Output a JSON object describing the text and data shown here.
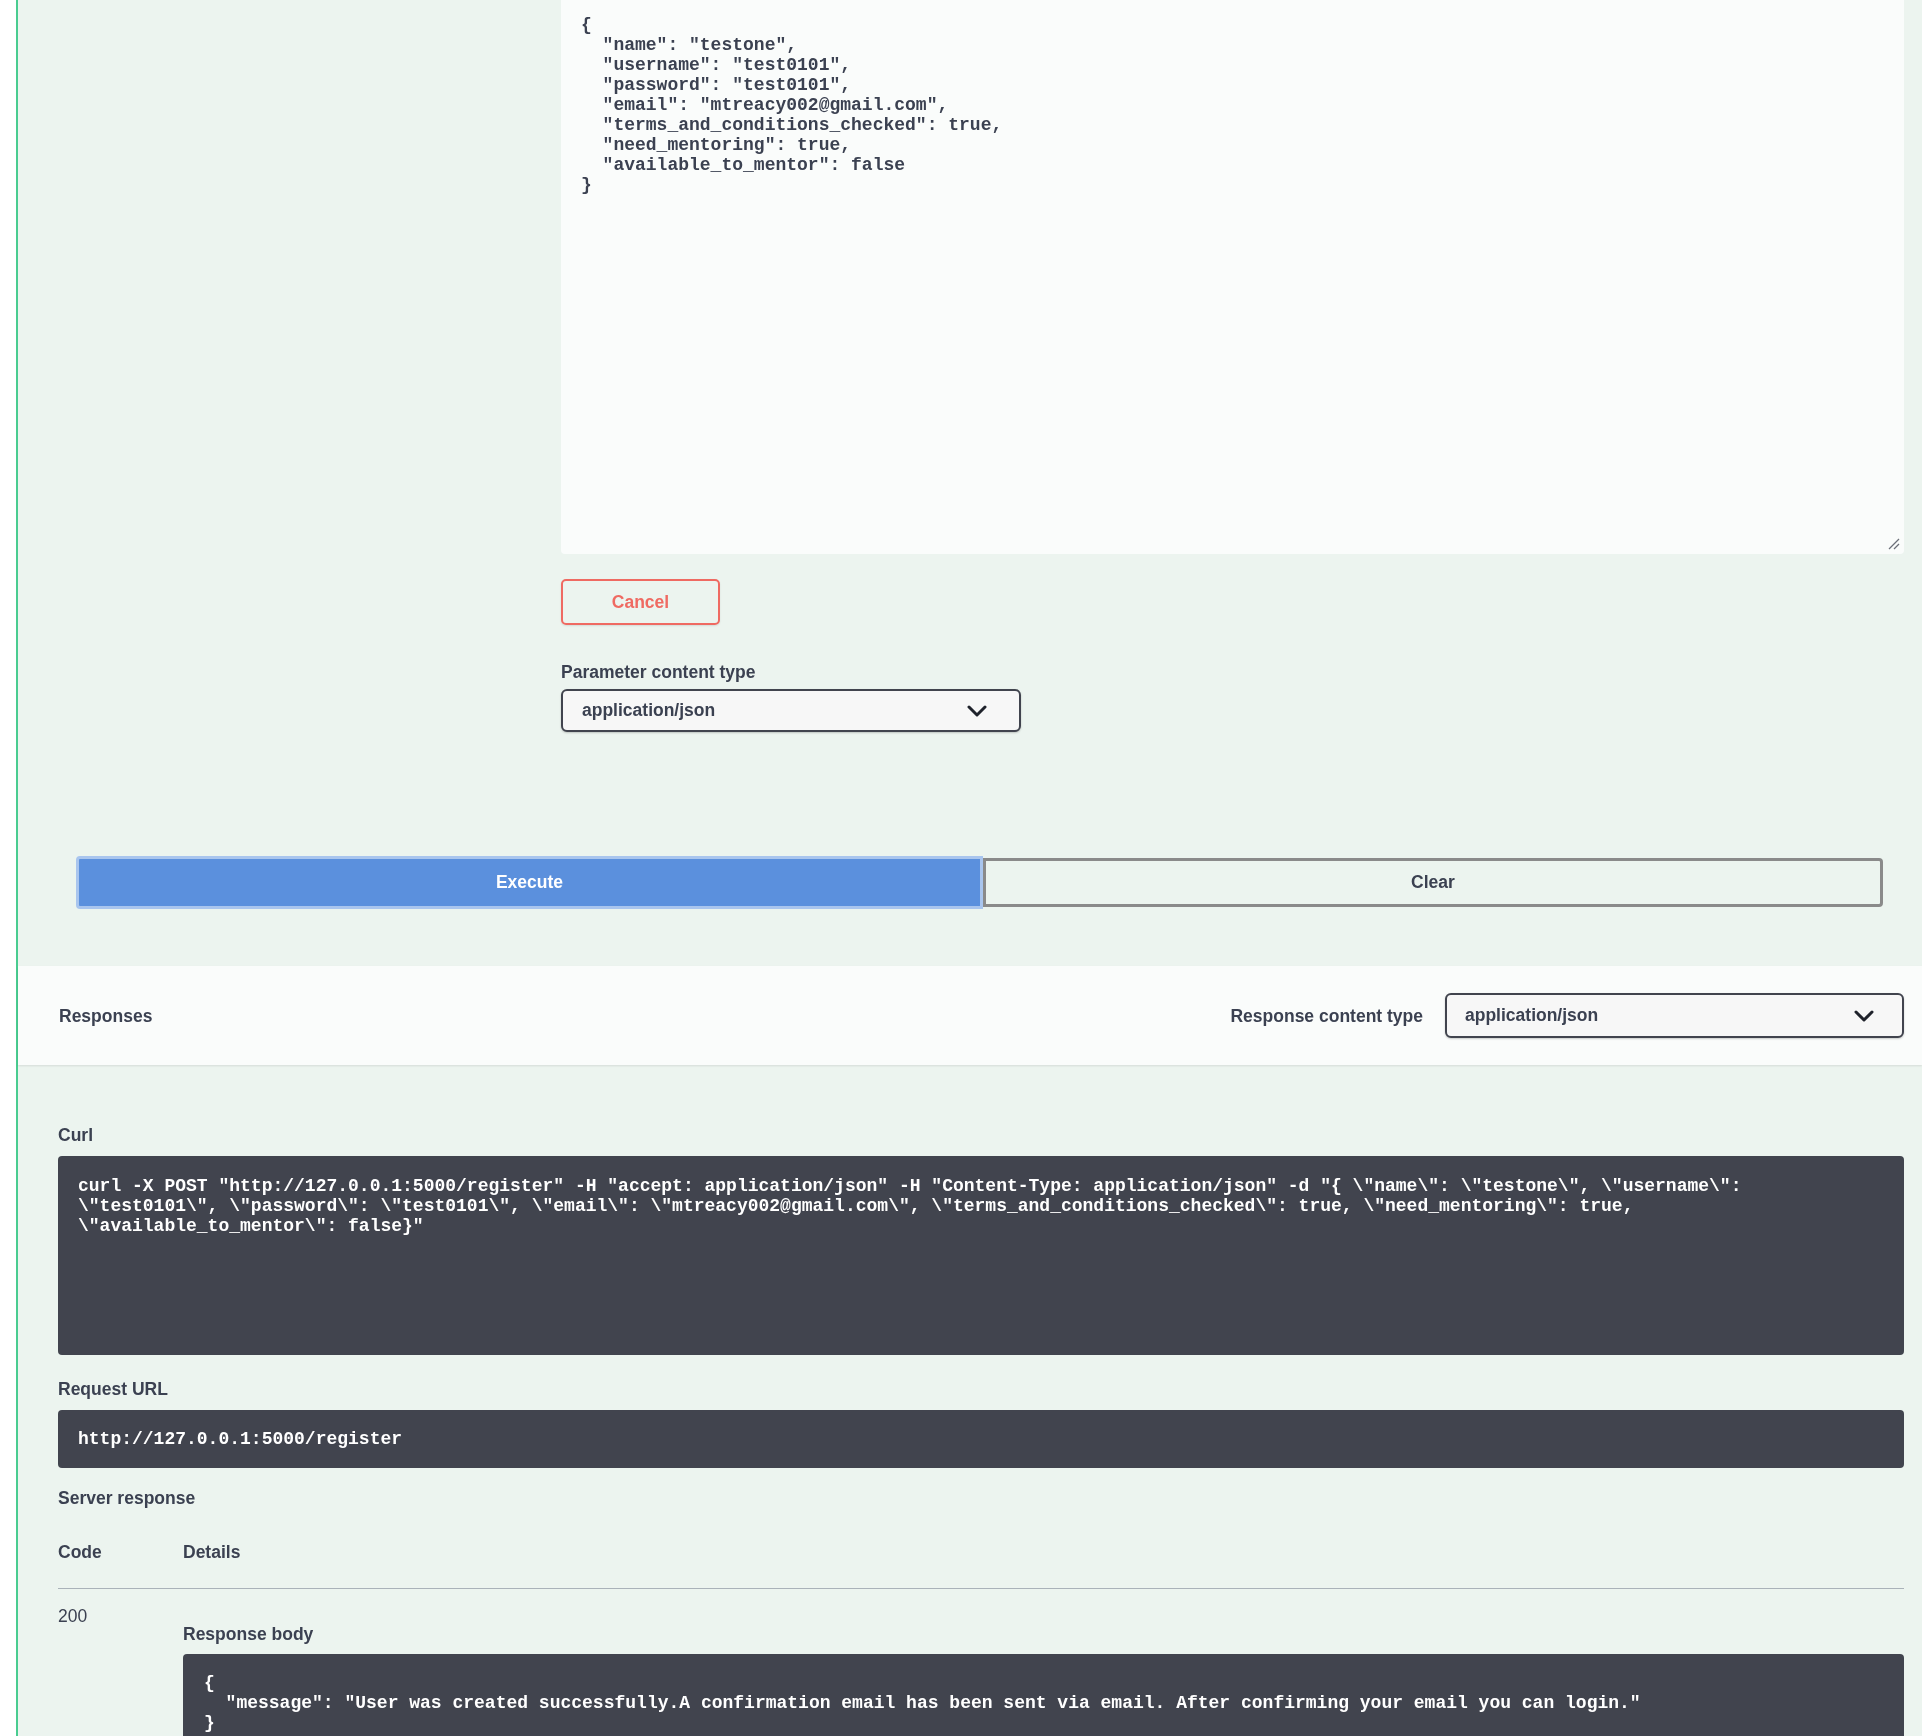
{
  "request_body": {
    "value": "{\n  \"name\": \"testone\",\n  \"username\": \"test0101\",\n  \"password\": \"test0101\",\n  \"email\": \"mtreacy002@gmail.com\",\n  \"terms_and_conditions_checked\": true,\n  \"need_mentoring\": true,\n  \"available_to_mentor\": false\n}"
  },
  "cancel_button": {
    "label": "Cancel"
  },
  "parameter_content_type": {
    "label": "Parameter content type",
    "value": "application/json"
  },
  "actions": [
    {
      "label": "Execute",
      "kind": "execute"
    },
    {
      "label": "Clear",
      "kind": "clear"
    }
  ],
  "responses": {
    "title": "Responses",
    "content_type": {
      "label": "Response content type",
      "value": "application/json"
    }
  },
  "curl": {
    "label": "Curl",
    "command": "curl -X POST \"http://127.0.0.1:5000/register\" -H \"accept: application/json\" -H \"Content-Type: application/json\" -d \"{ \\\"name\\\": \\\"testone\\\", \\\"username\\\": \\\"test0101\\\", \\\"password\\\": \\\"test0101\\\", \\\"email\\\": \\\"mtreacy002@gmail.com\\\", \\\"terms_and_conditions_checked\\\": true, \\\"need_mentoring\\\": true, \\\"available_to_mentor\\\": false}\""
  },
  "request_url": {
    "label": "Request URL",
    "value": "http://127.0.0.1:5000/register"
  },
  "server_response": {
    "title": "Server response",
    "columns": [
      "Code",
      "Details"
    ],
    "rows": [
      {
        "code": "200",
        "body_label": "Response body",
        "body": "{\n  \"message\": \"User was created successfully.A confirmation email has been sent via email. After confirming your email you can login.\"\n}"
      }
    ]
  }
}
